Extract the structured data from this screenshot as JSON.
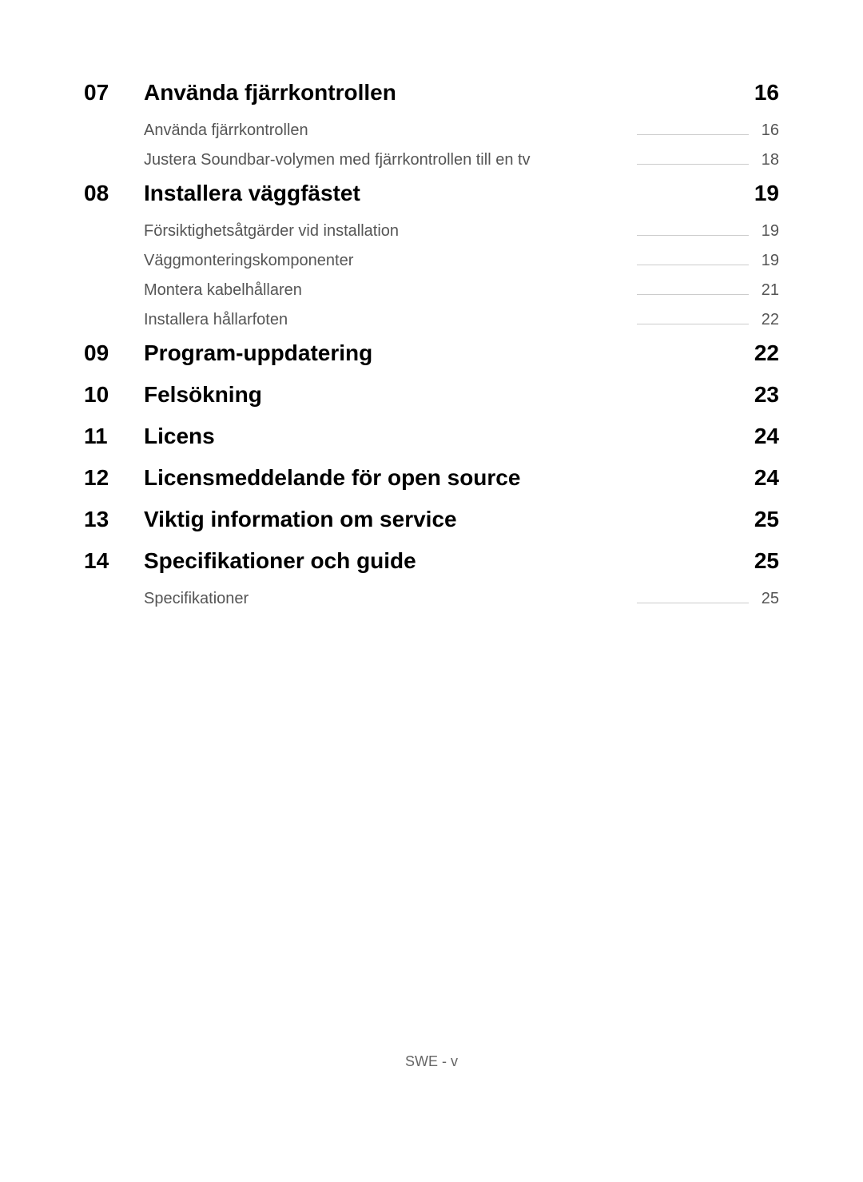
{
  "toc": [
    {
      "number": "07",
      "title": "Använda fjärrkontrollen",
      "page": "16",
      "subs": [
        {
          "title": "Använda fjärrkontrollen",
          "page": "16"
        },
        {
          "title": "Justera Soundbar-volymen med fjärrkontrollen till en tv",
          "page": "18"
        }
      ]
    },
    {
      "number": "08",
      "title": "Installera väggfästet",
      "page": "19",
      "subs": [
        {
          "title": "Försiktighetsåtgärder vid installation",
          "page": "19"
        },
        {
          "title": "Väggmonteringskomponenter",
          "page": "19"
        },
        {
          "title": "Montera kabelhållaren",
          "page": "21"
        },
        {
          "title": "Installera hållarfoten",
          "page": "22"
        }
      ]
    },
    {
      "number": "09",
      "title": "Program-uppdatering",
      "page": "22",
      "subs": []
    },
    {
      "number": "10",
      "title": "Felsökning",
      "page": "23",
      "subs": []
    },
    {
      "number": "11",
      "title": "Licens",
      "page": "24",
      "subs": []
    },
    {
      "number": "12",
      "title": "Licensmeddelande för open source",
      "page": "24",
      "subs": []
    },
    {
      "number": "13",
      "title": "Viktig information om service",
      "page": "25",
      "subs": []
    },
    {
      "number": "14",
      "title": "Specifikationer och guide",
      "page": "25",
      "subs": [
        {
          "title": "Specifikationer",
          "page": "25"
        }
      ]
    }
  ],
  "footer": "SWE - v"
}
